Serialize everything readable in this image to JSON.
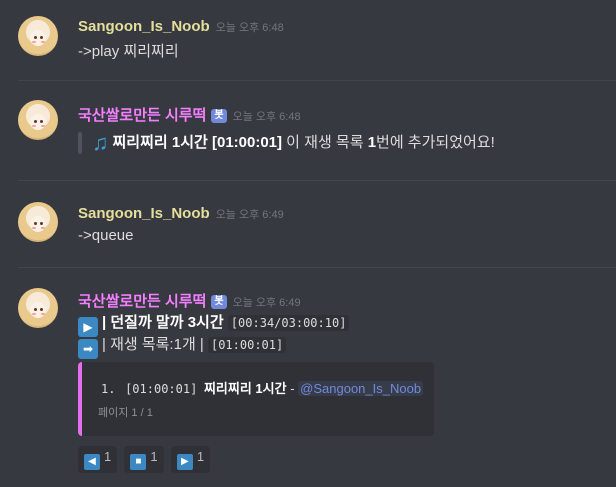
{
  "messages": [
    {
      "username": "Sangoon_Is_Noob",
      "timestamp": "오늘 오후 6:48",
      "text": "->play 찌리찌리"
    },
    {
      "username": "국산쌀로만든 시루떡",
      "bot_tag": "봇",
      "timestamp": "오늘 오후 6:48",
      "note_icon": "music-note-icon",
      "song_title": "찌리찌리 1시간 [01:00:01]",
      "text_pre": " 이 재생 목록 ",
      "num": "1",
      "text_post": "번에 추가되었어요!"
    },
    {
      "username": "Sangoon_Is_Noob",
      "timestamp": "오늘 오후 6:49",
      "text": "->queue"
    },
    {
      "username": "국산쌀로만든 시루떡",
      "bot_tag": "봇",
      "timestamp": "오늘 오후 6:49",
      "line1_label": "| 던질까 말까 3시간",
      "line1_code": "[00:34/03:00:10]",
      "line2_label": "| 재생 목록:1개 |",
      "line2_code": "[01:00:01]",
      "embed": {
        "index": "1.",
        "code": "[01:00:01]",
        "title": "찌리찌리 1시간",
        "dash": "-",
        "mention": "@Sangoon_Is_Noob",
        "footer": "페이지 1 / 1"
      },
      "reactions": [
        {
          "icon": "rewind-icon",
          "glyph": "◀",
          "count": "1"
        },
        {
          "icon": "stop-icon",
          "glyph": "■",
          "count": "1"
        },
        {
          "icon": "play-icon",
          "glyph": "▶",
          "count": "1"
        }
      ]
    }
  ],
  "colors": {
    "background": "#36393f",
    "user_name": "#e6df9b",
    "bot_name": "#f47fff",
    "embed_accent": "#e46fe8",
    "mention": "#7289da"
  }
}
